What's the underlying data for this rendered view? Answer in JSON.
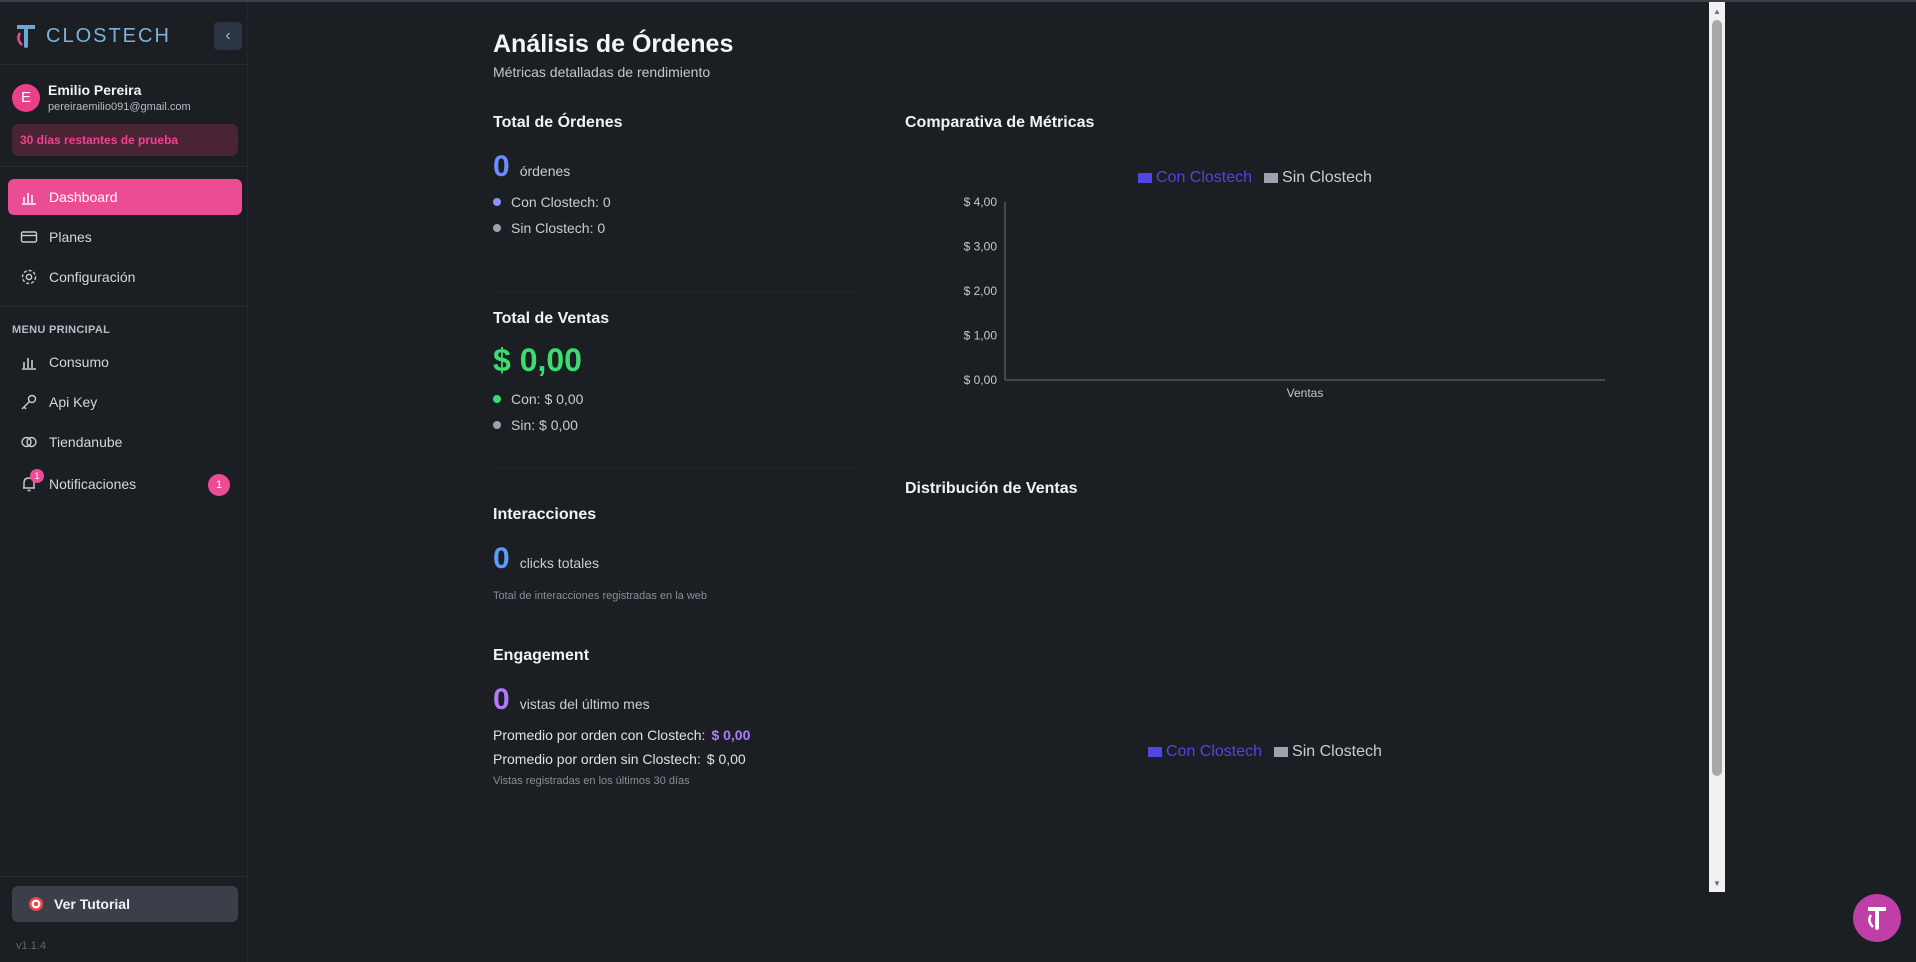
{
  "brand": {
    "name": "CLOSTECH",
    "collapse_icon": "chevron-left-icon"
  },
  "user": {
    "initial": "E",
    "name": "Emilio Pereira",
    "email": "pereiraemilio091@gmail.com",
    "trial": "30 días restantes de prueba"
  },
  "nav": {
    "dashboard": "Dashboard",
    "planes": "Planes",
    "configuracion": "Configuración"
  },
  "menu": {
    "section_title": "MENU PRINCIPAL",
    "consumo": "Consumo",
    "api_key": "Api Key",
    "tiendanube": "Tiendanube",
    "notificaciones": "Notificaciones",
    "bell_badge": "1",
    "notif_count": "1"
  },
  "footer": {
    "tutorial": "Ver Tutorial",
    "version": "v1.1.4"
  },
  "header": {
    "title": "Análisis de Órdenes",
    "subtitle": "Métricas detalladas de rendimiento"
  },
  "ordenes": {
    "title": "Total de Órdenes",
    "value": "0",
    "unit": "órdenes",
    "con": "Con Clostech: 0",
    "sin": "Sin Clostech: 0"
  },
  "ventas": {
    "title": "Total de Ventas",
    "value": "$ 0,00",
    "con": "Con: $ 0,00",
    "sin": "Sin: $ 0,00"
  },
  "interacciones": {
    "title": "Interacciones",
    "value": "0",
    "unit": "clicks totales",
    "note": "Total de interacciones registradas en la web"
  },
  "engagement": {
    "title": "Engagement",
    "value": "0",
    "unit": "vistas del último mes",
    "con_label": "Promedio por orden con Clostech:",
    "con_value": "$ 0,00",
    "sin_label": "Promedio por orden sin Clostech:",
    "sin_value": "$ 0,00",
    "note": "Vistas registradas en los últimos 30 días"
  },
  "colors": {
    "accent": "#ec4c93",
    "con": "#4f46e5",
    "sin": "#9ca3af",
    "ordenes_blue": "#6b8cff",
    "ventas_green": "#3ddc6f",
    "interacciones_blue": "#5b9cf6",
    "engagement_purple": "#b07cf6"
  },
  "chart_data": [
    {
      "type": "bar",
      "title": "Comparativa de Métricas",
      "categories": [
        "Ventas"
      ],
      "series": [
        {
          "name": "Con Clostech",
          "values": [
            0
          ]
        },
        {
          "name": "Sin Clostech",
          "values": [
            0
          ]
        }
      ],
      "yticks": [
        "$ 0,00",
        "$ 1,00",
        "$ 2,00",
        "$ 3,00",
        "$ 4,00"
      ],
      "ylim": [
        0,
        4
      ],
      "legend": "top-center"
    },
    {
      "type": "pie",
      "title": "Distribución de Ventas",
      "categories": [
        "Con Clostech",
        "Sin Clostech"
      ],
      "values": [
        0,
        0
      ],
      "legend": "bottom-center"
    }
  ]
}
